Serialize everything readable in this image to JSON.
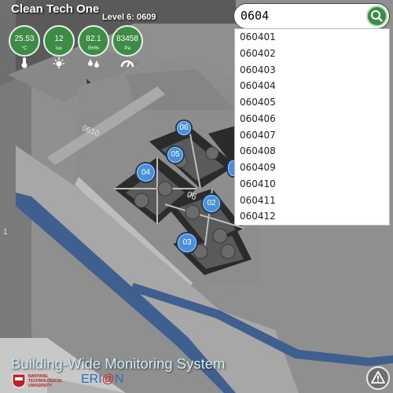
{
  "header": {
    "title": "Clean Tech One",
    "level": "Level 6: 0609"
  },
  "sensors": [
    {
      "name": "temperature",
      "value": "25.53",
      "unit": "°C",
      "icon": "thermometer-icon"
    },
    {
      "name": "light",
      "value": "12",
      "unit": "lux",
      "icon": "sun-icon"
    },
    {
      "name": "humidity",
      "value": "82.1",
      "unit": "RH%",
      "icon": "water-drops-icon"
    },
    {
      "name": "pressure",
      "value": "83458",
      "unit": "Pa",
      "icon": "gauge-icon"
    }
  ],
  "floor_labels": {
    "corridor": "0610",
    "zone": "06",
    "left_edge": "1"
  },
  "markers": [
    "06",
    "05",
    "04",
    "02",
    "03"
  ],
  "search": {
    "value": "0604",
    "results": [
      "060401",
      "060402",
      "060403",
      "060404",
      "060405",
      "060406",
      "060407",
      "060408",
      "060409",
      "060410",
      "060411",
      "060412"
    ]
  },
  "footer": {
    "title": "Building-Wide Monitoring System",
    "university_lines": [
      "NANYANG",
      "TECHNOLOGICAL",
      "UNIVERSITY"
    ],
    "erian_prefix": "ERI",
    "erian_at": "@",
    "erian_suffix": "N"
  },
  "colors": {
    "sensor_green": "#3e8a47",
    "marker_blue": "#4a90d9",
    "floor_gray": "#8e8e8e",
    "corridor_blue": "#3f5f8f"
  }
}
